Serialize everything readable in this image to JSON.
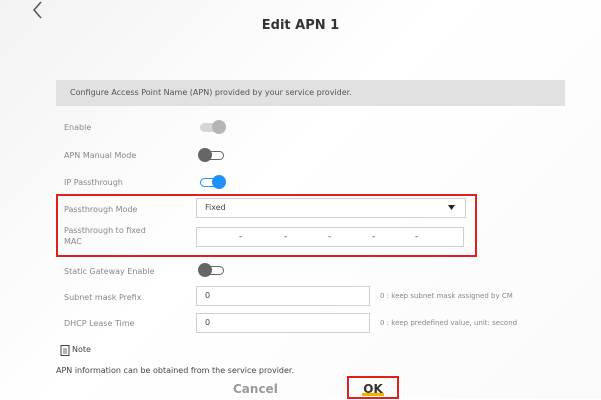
{
  "header": {
    "title": "Edit APN 1"
  },
  "banner": {
    "text": "Configure Access Point Name (APN) provided by your service provider."
  },
  "settings": {
    "enable_label": "Enable",
    "apn_manual_label": "APN Manual Mode",
    "ip_passthrough_label": "IP Passthrough",
    "passthrough_mode_label": "Passthrough Mode",
    "passthrough_mode_value": "Fixed",
    "passthrough_mac_label_line1": "Passthrough to fixed",
    "passthrough_mac_label_line2": "MAC",
    "mac_separator": "-",
    "static_gateway_label": "Static Gateway Enable",
    "subnet_mask_label": "Subnet mask Prefix",
    "subnet_mask_value": "0",
    "subnet_mask_hint": "0 : keep subnet mask assigned by CM",
    "dhcp_lease_label": "DHCP Lease Time",
    "dhcp_lease_value": "0",
    "dhcp_lease_hint": "0 : keep predefined value, unit: second"
  },
  "toggles": {
    "enable": {
      "on": true,
      "disabled": true
    },
    "apn_manual_mode": {
      "on": false
    },
    "ip_passthrough": {
      "on": true
    },
    "static_gateway": {
      "on": false
    }
  },
  "note": {
    "label": "Note",
    "text": "APN information can be obtained from the service provider."
  },
  "actions": {
    "cancel_label": "Cancel",
    "ok_label": "OK"
  },
  "colors": {
    "accent": "#1e90ff",
    "highlight": "#e02020",
    "ok_underline": "#f0b400",
    "toggle_off": "#666666",
    "toggle_disabled": "#b5b5b5"
  },
  "icons": {
    "back": "chevron-left-icon",
    "note": "note-icon",
    "dropdown": "caret-down-icon"
  }
}
